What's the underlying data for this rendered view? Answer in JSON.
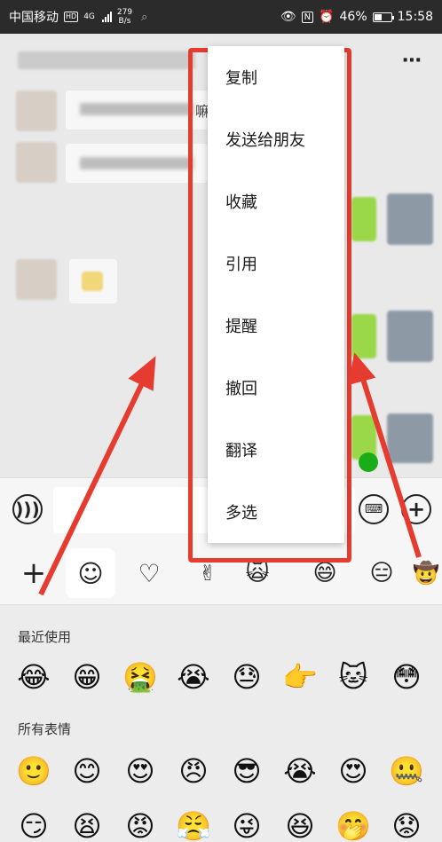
{
  "status_bar": {
    "carrier": "中国移动",
    "hd_badge": "HD",
    "network": "4G",
    "speed_value": "279",
    "speed_unit": "B/s",
    "battery": "46%",
    "time": "15:58"
  },
  "chat": {
    "partial_text": "嘛"
  },
  "context_menu": {
    "items": [
      "复制",
      "发送给朋友",
      "收藏",
      "引用",
      "提醒",
      "撤回",
      "翻译",
      "多选"
    ]
  },
  "input_bar": {
    "voice_icon": "voice-icon",
    "keyboard_icon": "keyboard-icon",
    "plus_icon": "plus-icon"
  },
  "emoji_panel": {
    "recent_title": "最近使用",
    "all_title": "所有表情",
    "recent": [
      "😂",
      "😁",
      "🤮",
      "😭",
      "😓",
      "👉",
      "🐱",
      "😳"
    ],
    "all_row1": [
      "🙂",
      "😊",
      "😍",
      "😠",
      "😎",
      "😭",
      "😍",
      "🤐"
    ],
    "all_row2": [
      "😏",
      "😫",
      "😡",
      "😤",
      "😜",
      "😆",
      "🤭",
      "😟"
    ]
  },
  "colors": {
    "highlight": "#e53c2f",
    "status_bar": "#2b2b2b"
  }
}
